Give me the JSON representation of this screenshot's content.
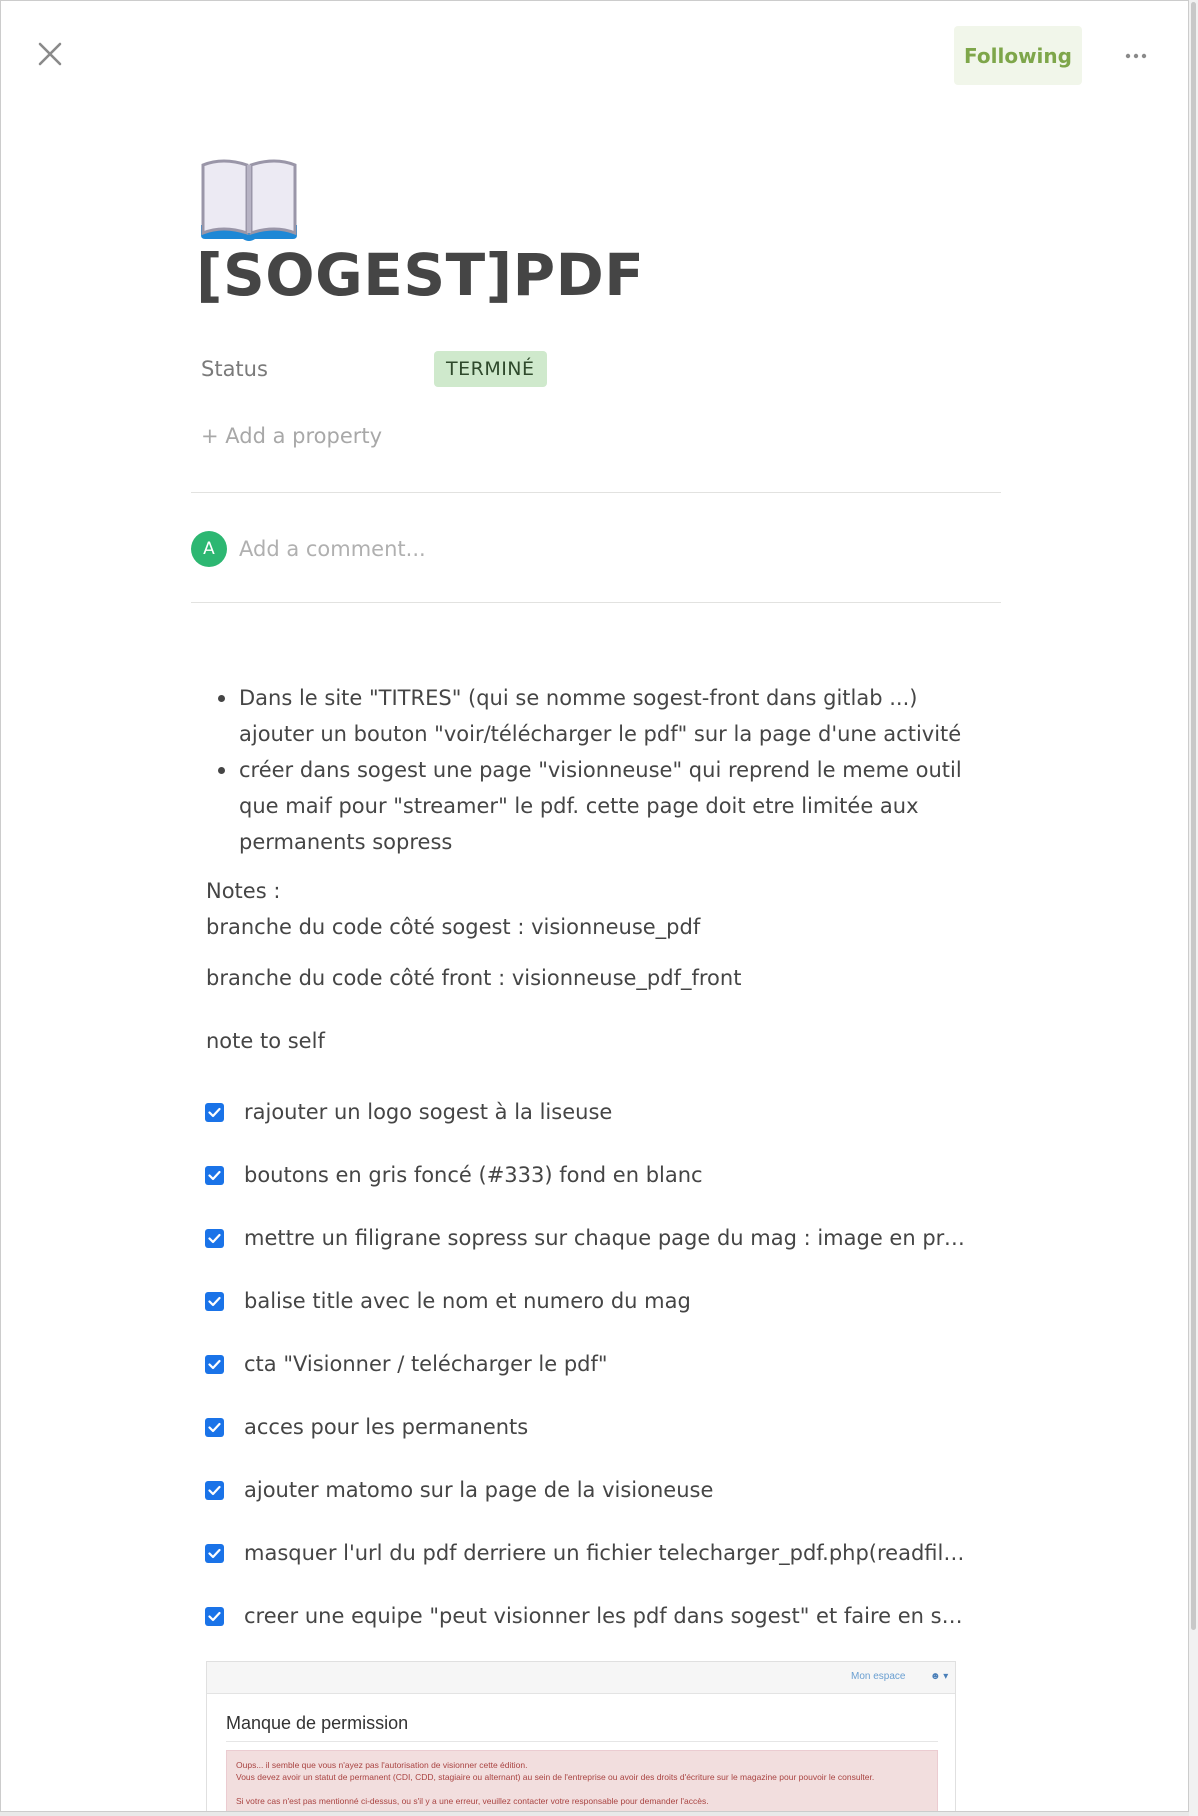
{
  "header": {
    "follow_label": "Following"
  },
  "page": {
    "title": "[SOGEST]PDF",
    "icon": "open-book-emoji"
  },
  "properties": {
    "status_label": "Status",
    "status_value": "TERMINÉ",
    "add_property_label": "+ Add a property"
  },
  "comment": {
    "avatar_initial": "A",
    "placeholder": "Add a comment..."
  },
  "body": {
    "bullets": [
      "Dans le site \"TITRES\" (qui se nomme sogest-front dans gitlab ...) ajouter un bouton \"voir/télécharger le pdf\" sur la page d'une activité",
      "créer dans sogest une page \"visionneuse\" qui reprend le meme outil que maif pour \"streamer\" le pdf. cette page doit etre limitée aux permanents sopress"
    ],
    "notes_label": "Notes :",
    "branch_sogest": "branche du code côté sogest : visionneuse_pdf",
    "branch_front": "branche du code côté front : visionneuse_pdf_front",
    "note_to_self": "note to self",
    "todos": [
      {
        "label": "rajouter un logo sogest à la liseuse",
        "checked": true
      },
      {
        "label": "boutons en gris foncé (#333) fond en blanc",
        "checked": true
      },
      {
        "label": "mettre un filigrane sopress sur chaque page du mag : image en proportion de la page",
        "checked": true
      },
      {
        "label": "balise title avec le nom et numero du mag",
        "checked": true
      },
      {
        "label": "cta \"Visionner / telécharger le pdf\"",
        "checked": true
      },
      {
        "label": "acces pour les permanents",
        "checked": true
      },
      {
        "label": "ajouter matomo sur la page de la visioneuse",
        "checked": true
      },
      {
        "label": "masquer l'url du pdf derriere un fichier telecharger_pdf.php(readfile en php)",
        "checked": true
      },
      {
        "label": "creer une equipe \"peut visionner les pdf dans sogest\" et faire en sorte que seuls ses membres y aient accès",
        "checked": true
      }
    ]
  },
  "embedded_screenshot": {
    "nav_link": "Mon espace",
    "heading": "Manque de permission",
    "alert_line1": "Oups... il semble que vous n'ayez pas l'autorisation de visionner cette édition.",
    "alert_line2": "Vous devez avoir un statut de permanent (CDI, CDD, stagiaire ou alternant) au sein de l'entreprise ou avoir des droits d'écriture sur le magazine pour pouvoir le consulter.",
    "alert_line3": "Si votre cas n'est pas mentionné ci-dessus, ou s'il y a une erreur, veuillez contacter votre responsable pour demander l'accès."
  },
  "colors": {
    "follow_bg": "#f1f6ea",
    "follow_text": "#7ea64a",
    "status_bg": "#cfe9cc",
    "avatar_bg": "#2db772",
    "checkbox": "#1a73e8"
  }
}
